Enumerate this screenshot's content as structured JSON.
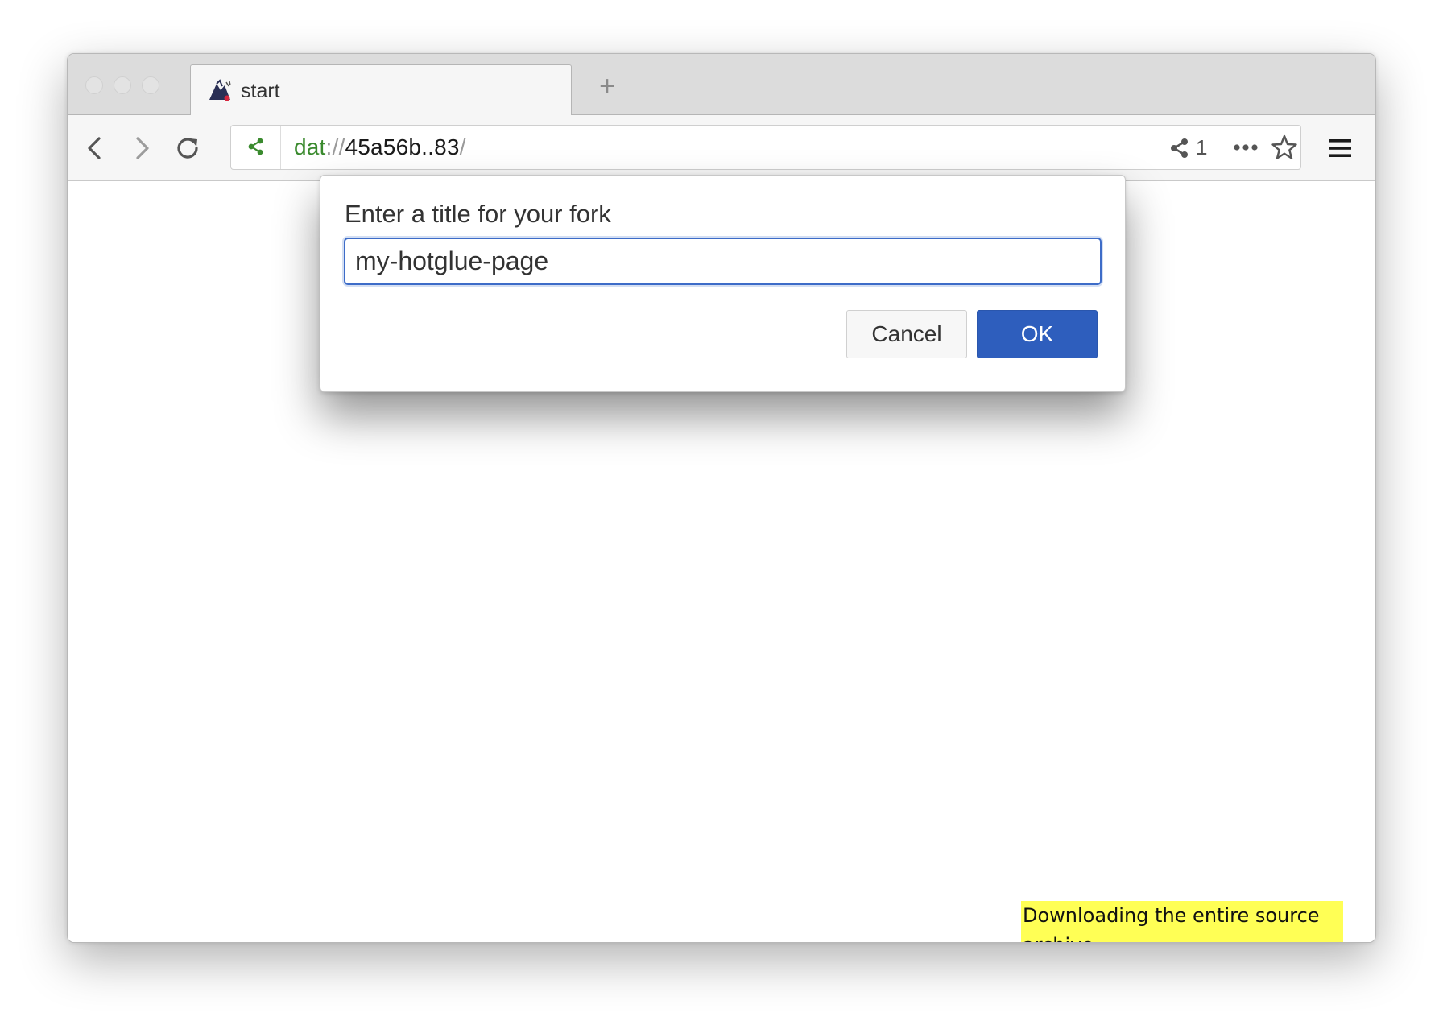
{
  "browser": {
    "tab": {
      "title": "start",
      "icon": "hotglue-favicon-icon"
    },
    "new_tab_label": "+",
    "url": {
      "scheme": "dat",
      "separator": "://",
      "host": "45a56b..83",
      "trailing": "/"
    },
    "peer_count": "1",
    "icons": {
      "back": "chevron-left-icon",
      "forward": "chevron-right-icon",
      "reload": "reload-icon",
      "share": "share-icon",
      "more": "more-dots-icon",
      "bookmark": "star-icon",
      "menu": "hamburger-icon"
    },
    "colors": {
      "secure_scheme": "#3a8a2e",
      "share_green": "#3a8a2e"
    }
  },
  "dialog": {
    "prompt": "Enter a title for your fork",
    "input_value": "my-hotglue-page",
    "cancel_label": "Cancel",
    "ok_label": "OK",
    "colors": {
      "ok_button": "#2e5ebd",
      "input_focus": "#3d6cc8"
    }
  },
  "page": {
    "status_text": "Downloading the entire source archive...",
    "colors": {
      "status_background": "#ffff55"
    }
  }
}
